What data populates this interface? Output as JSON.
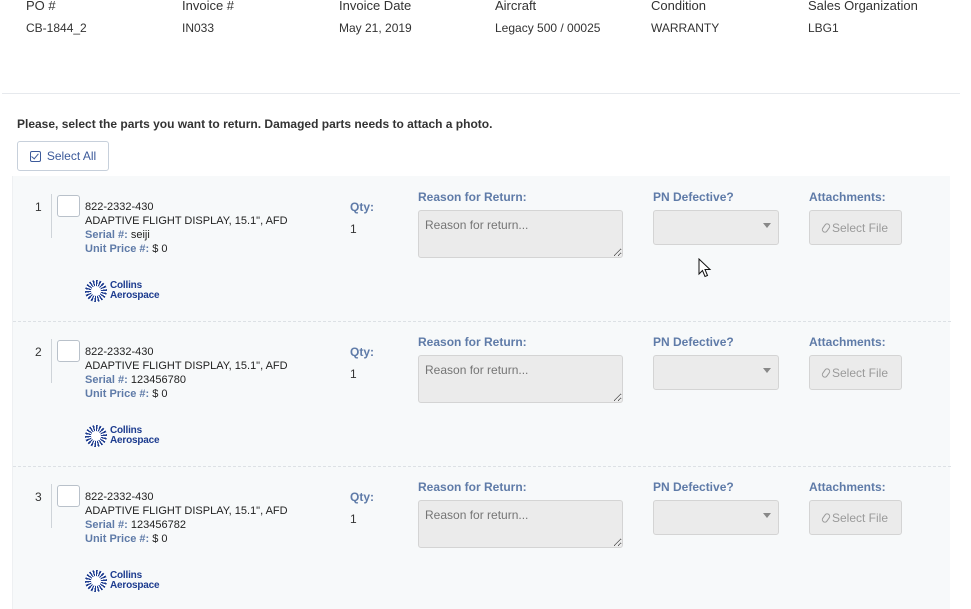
{
  "header": {
    "columns": [
      {
        "label": "PO #",
        "value": "CB-1844_2"
      },
      {
        "label": "Invoice #",
        "value": "IN033"
      },
      {
        "label": "Invoice Date",
        "value": "May 21, 2019"
      },
      {
        "label": "Aircraft",
        "value": "Legacy 500 / 00025"
      },
      {
        "label": "Condition",
        "value": "WARRANTY"
      },
      {
        "label": "Sales Organization",
        "value": "LBG1"
      }
    ]
  },
  "instructions": "Please, select the parts you want to return. Damaged parts needs to attach a photo.",
  "select_all_label": "Select All",
  "field_labels": {
    "qty": "Qty:",
    "reason": "Reason for Return:",
    "pn_defective": "PN Defective?",
    "attachments": "Attachments:",
    "serial": "Serial #:",
    "unit_price": "Unit Price #:",
    "reason_placeholder": "Reason for return...",
    "select_file": "Select File"
  },
  "brand": {
    "line1": "Collins",
    "line2": "Aerospace"
  },
  "rows": [
    {
      "num": "1",
      "pn": "822-2332-430",
      "desc": "ADAPTIVE FLIGHT DISPLAY, 15.1\", AFD",
      "serial": "seiji",
      "price": "$ 0",
      "qty": "1"
    },
    {
      "num": "2",
      "pn": "822-2332-430",
      "desc": "ADAPTIVE FLIGHT DISPLAY, 15.1\", AFD",
      "serial": "123456780",
      "price": "$ 0",
      "qty": "1"
    },
    {
      "num": "3",
      "pn": "822-2332-430",
      "desc": "ADAPTIVE FLIGHT DISPLAY, 15.1\", AFD",
      "serial": "123456782",
      "price": "$ 0",
      "qty": "1"
    }
  ],
  "colors": {
    "label_blue": "#5f7ba8",
    "brand_blue": "#1d3c8f",
    "disabled_bg": "#ebebeb"
  }
}
